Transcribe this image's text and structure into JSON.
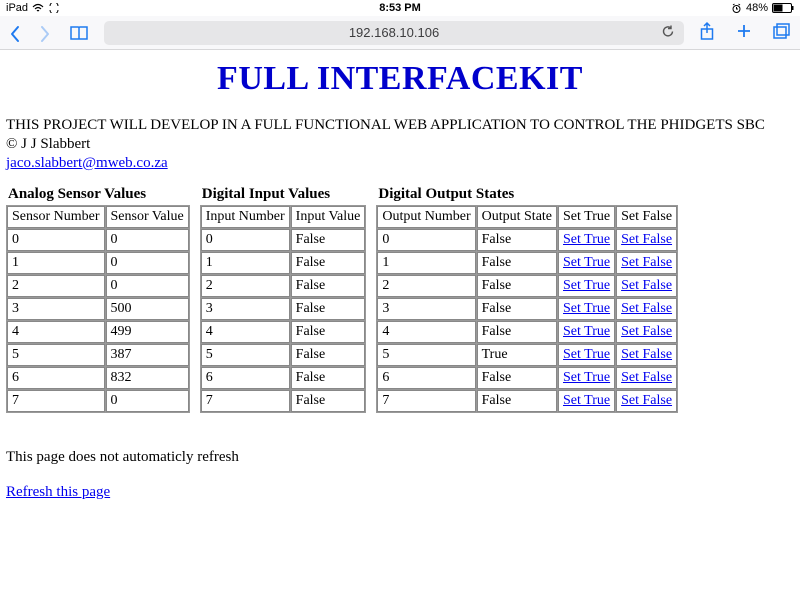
{
  "status": {
    "device": "iPad",
    "time": "8:53 PM",
    "battery_pct": "48%"
  },
  "toolbar": {
    "address": "192.168.10.106"
  },
  "content": {
    "title": "FULL INTERFACEKIT",
    "intro_line": "THIS PROJECT WILL DEVELOP IN A FULL FUNCTIONAL WEB APPLICATION TO CONTROL THE PHIDGETS SBC",
    "copyright": "© J J Slabbert",
    "email": "jaco.slabbert@mweb.co.za",
    "footer_note": "This page does not automaticly refresh",
    "refresh_label": "Refresh this page"
  },
  "tables": {
    "analog": {
      "caption": "Analog Sensor Values",
      "headers": [
        "Sensor Number",
        "Sensor Value"
      ],
      "rows": [
        [
          "0",
          "0"
        ],
        [
          "1",
          "0"
        ],
        [
          "2",
          "0"
        ],
        [
          "3",
          "500"
        ],
        [
          "4",
          "499"
        ],
        [
          "5",
          "387"
        ],
        [
          "6",
          "832"
        ],
        [
          "7",
          "0"
        ]
      ]
    },
    "digital_in": {
      "caption": "Digital Input Values",
      "headers": [
        "Input Number",
        "Input Value"
      ],
      "rows": [
        [
          "0",
          "False"
        ],
        [
          "1",
          "False"
        ],
        [
          "2",
          "False"
        ],
        [
          "3",
          "False"
        ],
        [
          "4",
          "False"
        ],
        [
          "5",
          "False"
        ],
        [
          "6",
          "False"
        ],
        [
          "7",
          "False"
        ]
      ]
    },
    "digital_out": {
      "caption": "Digital Output States",
      "headers": [
        "Output Number",
        "Output State",
        "Set True",
        "Set False"
      ],
      "rows": [
        {
          "n": "0",
          "state": "False"
        },
        {
          "n": "1",
          "state": "False"
        },
        {
          "n": "2",
          "state": "False"
        },
        {
          "n": "3",
          "state": "False"
        },
        {
          "n": "4",
          "state": "False"
        },
        {
          "n": "5",
          "state": "True"
        },
        {
          "n": "6",
          "state": "False"
        },
        {
          "n": "7",
          "state": "False"
        }
      ],
      "link_true": "Set True",
      "link_false": "Set False"
    }
  }
}
